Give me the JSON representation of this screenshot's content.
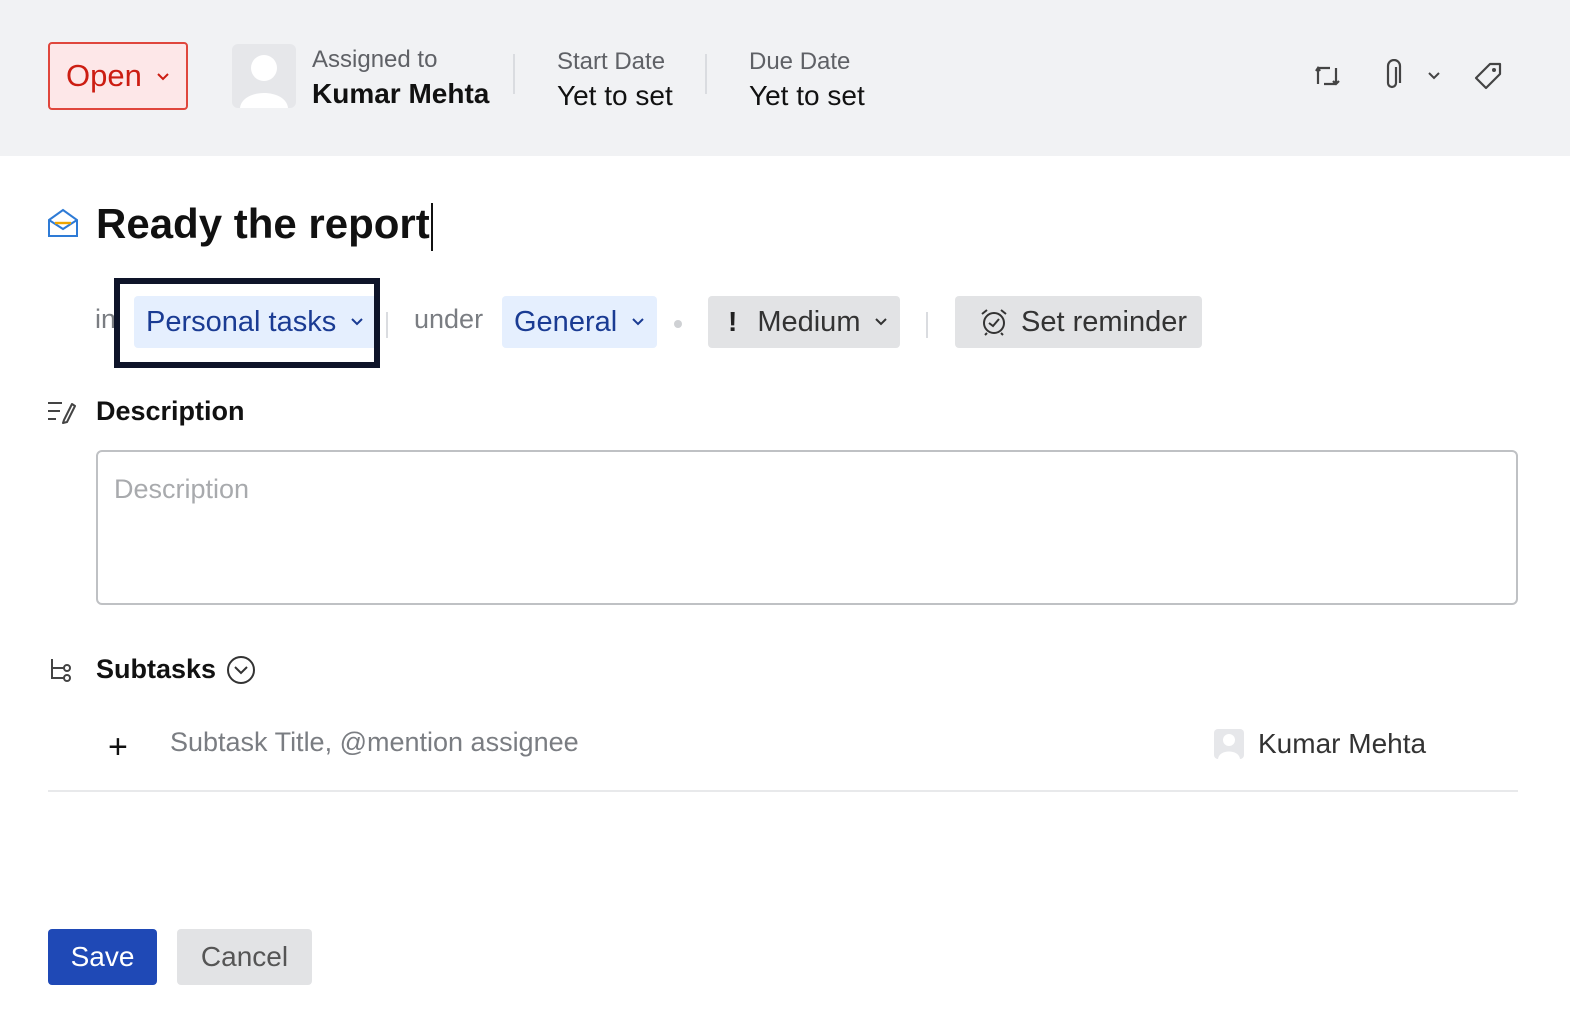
{
  "header": {
    "status": "Open",
    "assigned_label": "Assigned to",
    "assignee": "Kumar Mehta",
    "start_date_label": "Start Date",
    "start_date_value": "Yet to set",
    "due_date_label": "Due Date",
    "due_date_value": "Yet to set",
    "icons": [
      "swap-icon",
      "attachment-icon",
      "chevron-down-icon",
      "tag-icon"
    ]
  },
  "task": {
    "title": "Ready the report",
    "in_label": "in",
    "list": "Personal tasks",
    "under_label": "under",
    "section": "General",
    "priority": "Medium",
    "reminder": "Set reminder"
  },
  "description": {
    "heading": "Description",
    "placeholder": "Description"
  },
  "subtasks": {
    "heading": "Subtasks",
    "plus": "+",
    "placeholder": "Subtask Title, @mention assignee",
    "assignee": "Kumar Mehta"
  },
  "footer": {
    "save_label": "Save",
    "cancel_label": "Cancel"
  },
  "colors": {
    "status_red": "#cc1d12",
    "status_bg": "#fde7e8",
    "chip_blue": "#1a3b93",
    "chip_blue_bg": "#e5effe",
    "save_blue": "#1f49b6",
    "highlight": "#0e1429"
  }
}
